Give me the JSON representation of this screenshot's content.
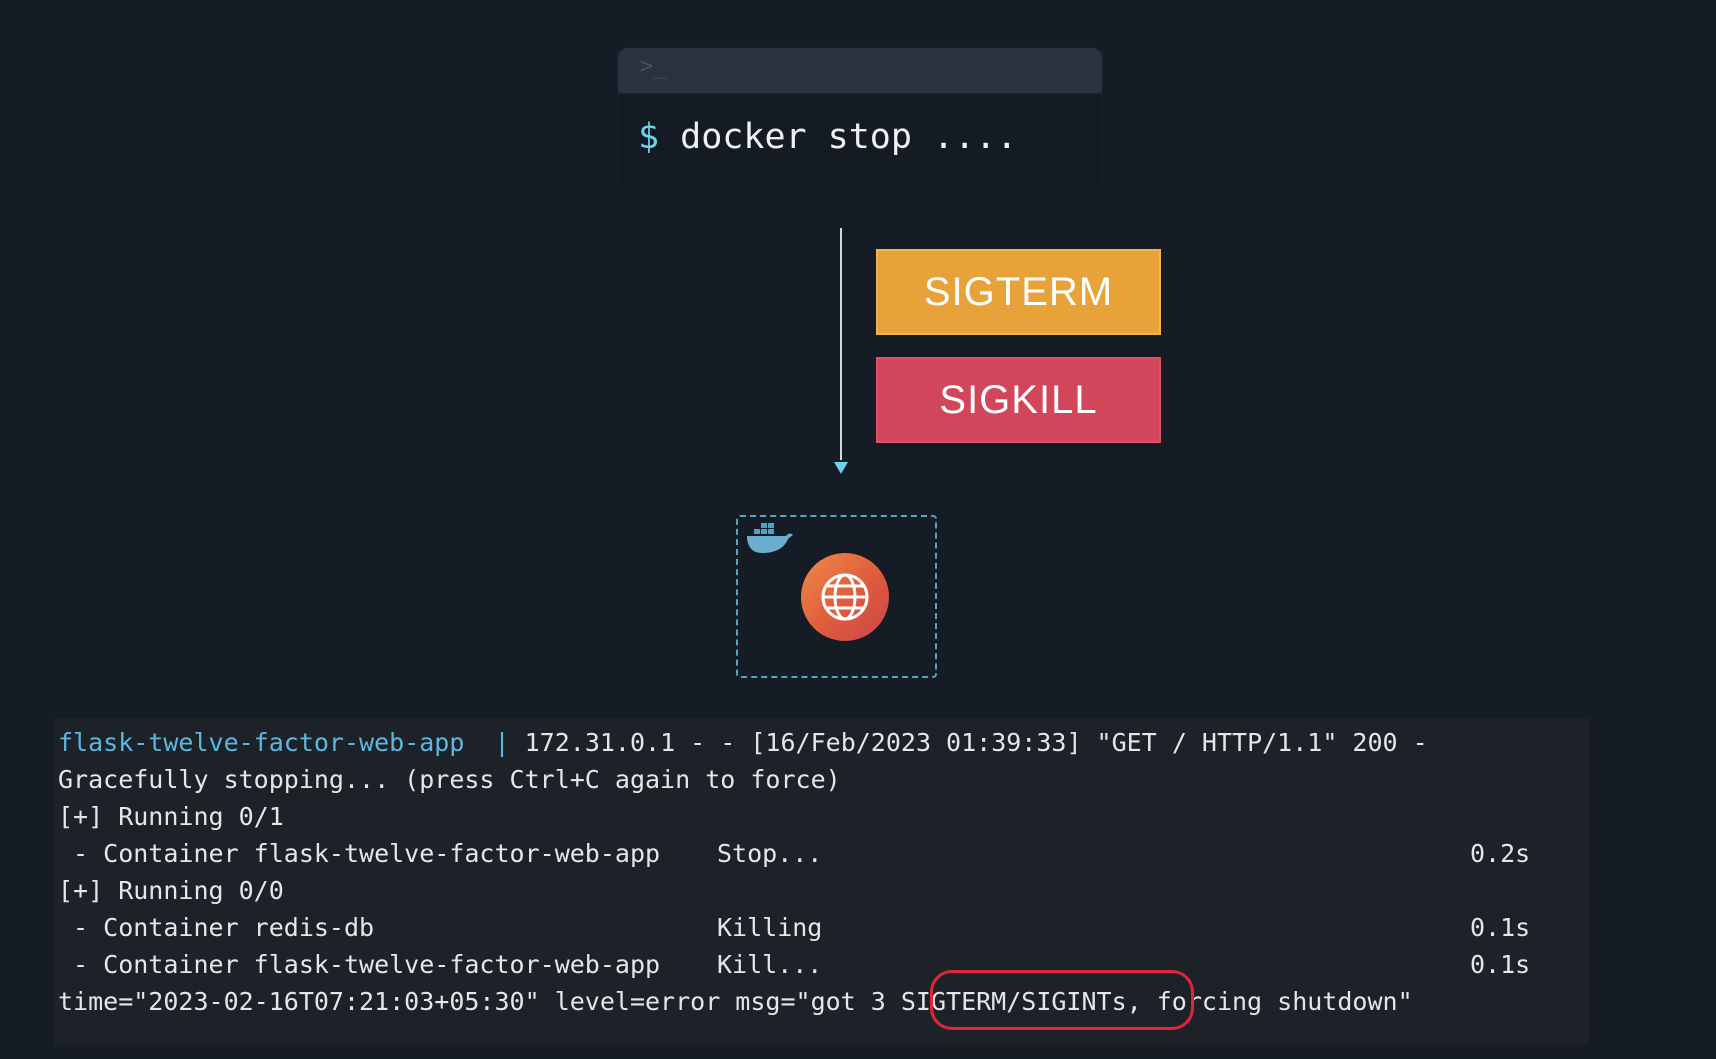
{
  "terminal": {
    "prompt_icon": ">_",
    "dollar": "$",
    "command": "docker stop ...."
  },
  "signals": {
    "sigterm": "SIGTERM",
    "sigkill": "SIGKILL"
  },
  "colors": {
    "sigterm": "#e8a23a",
    "sigkill": "#d2465c",
    "accent": "#6fd3e8"
  },
  "container": {
    "icon": "docker-whale-icon",
    "app_icon": "globe-icon"
  },
  "log": {
    "line1_service": "flask-twelve-factor-web-app",
    "line1_pipe": "|",
    "line1_rest": " 172.31.0.1 - - [16/Feb/2023 01:39:33] \"GET / HTTP/1.1\" 200 -",
    "line2": "Gracefully stopping... (press Ctrl+C again to force)",
    "line3": "[+] Running 0/1",
    "line4_left": " - Container flask-twelve-factor-web-app",
    "line4_status": "Stop...",
    "line4_time": "0.2s",
    "line5": "[+] Running 0/0",
    "line6_left": " - Container redis-db",
    "line6_status": "Killing",
    "line6_time": "0.1s",
    "line7_left": " - Container flask-twelve-factor-web-app",
    "line7_status": "Kill...",
    "line7_time": "0.1s",
    "line8": "time=\"2023-02-16T07:21:03+05:30\" level=error msg=\"got 3 SIGTERM/SIGINTs, forcing shutdown\""
  }
}
